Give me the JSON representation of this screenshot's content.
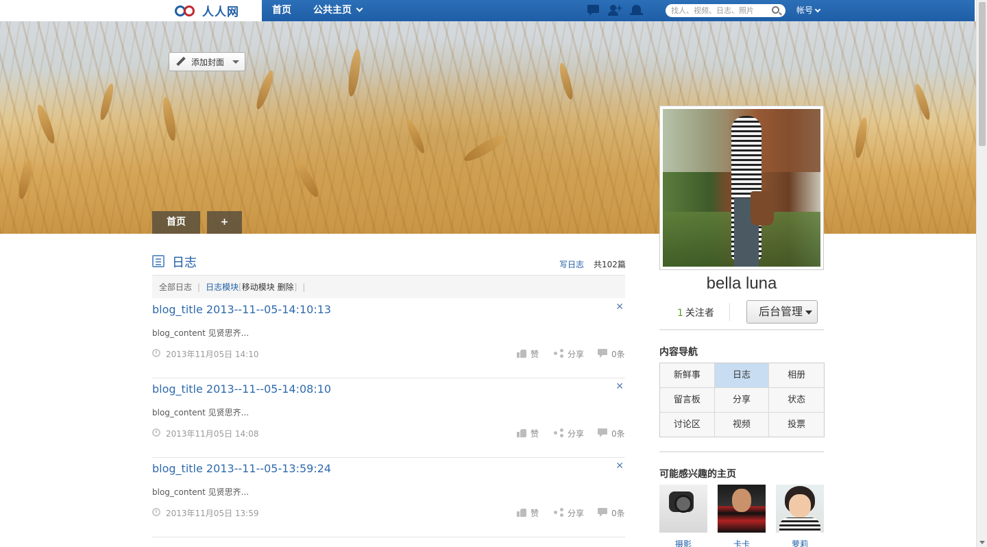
{
  "topbar": {
    "logo_text": "人人网",
    "nav_home": "首页",
    "nav_public": "公共主页",
    "search_placeholder": "找人、视频、日志、照片",
    "account": "帐号"
  },
  "cover": {
    "add_cover": "添加封面",
    "tabs": [
      "首页",
      "+"
    ]
  },
  "profile": {
    "name": "bella luna",
    "followers_count": "1",
    "followers_label": "关注者",
    "admin_button": "后台管理"
  },
  "content_nav": {
    "title": "内容导航",
    "items": [
      "新鲜事",
      "日志",
      "相册",
      "留言板",
      "分享",
      "状态",
      "讨论区",
      "视频",
      "投票"
    ],
    "active": "日志"
  },
  "interests": {
    "title": "可能感兴趣的主页",
    "items": [
      {
        "name": "摄影"
      },
      {
        "name": "卡卡"
      },
      {
        "name": "萝莉"
      }
    ]
  },
  "blog": {
    "title": "日志",
    "write": "写日志",
    "total": "共102篇",
    "filters": {
      "all": "全部日志",
      "module": "日志模块",
      "move": "移动模块",
      "delete": "删除"
    },
    "actions": {
      "like": "赞",
      "share": "分享"
    },
    "posts": [
      {
        "title": "blog_title 2013--11--05-14:10:13",
        "content": "blog_content 见贤思齐...",
        "date": "2013年11月05日 14:10",
        "comments": "0条"
      },
      {
        "title": "blog_title 2013--11--05-14:08:10",
        "content": "blog_content 见贤思齐...",
        "date": "2013年11月05日 14:08",
        "comments": "0条"
      },
      {
        "title": "blog_title 2013--11--05-13:59:24",
        "content": "blog_content 见贤思齐...",
        "date": "2013年11月05日 13:59",
        "comments": "0条"
      }
    ]
  },
  "colors": {
    "brand_blue": "#1f5ea6",
    "link_blue": "#2e6aad",
    "active_nav": "#c8ddf2",
    "follower_green": "#5b9a1f"
  }
}
